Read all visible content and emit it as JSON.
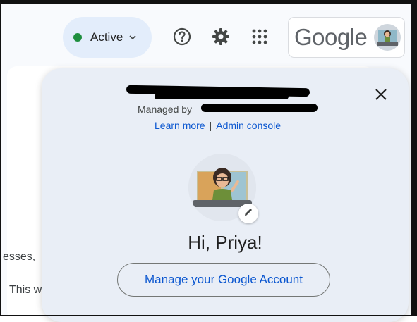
{
  "header": {
    "status_label": "Active",
    "status_color": "#1e8e3e",
    "icons": [
      "help-icon",
      "gear-icon",
      "apps-grid-icon",
      "chevron-down-icon"
    ],
    "brand": "Google"
  },
  "background": {
    "text1": "esses,",
    "text2": "This w"
  },
  "account_popup": {
    "managed_prefix": "Managed by",
    "learn_more": "Learn more",
    "separator": "|",
    "admin_console": "Admin console",
    "greeting": "Hi, Priya!",
    "manage_button": "Manage your Google Account"
  },
  "colors": {
    "link": "#0b57d0",
    "popup_bg": "#e9eef6",
    "pill_bg": "#e3edfb"
  }
}
